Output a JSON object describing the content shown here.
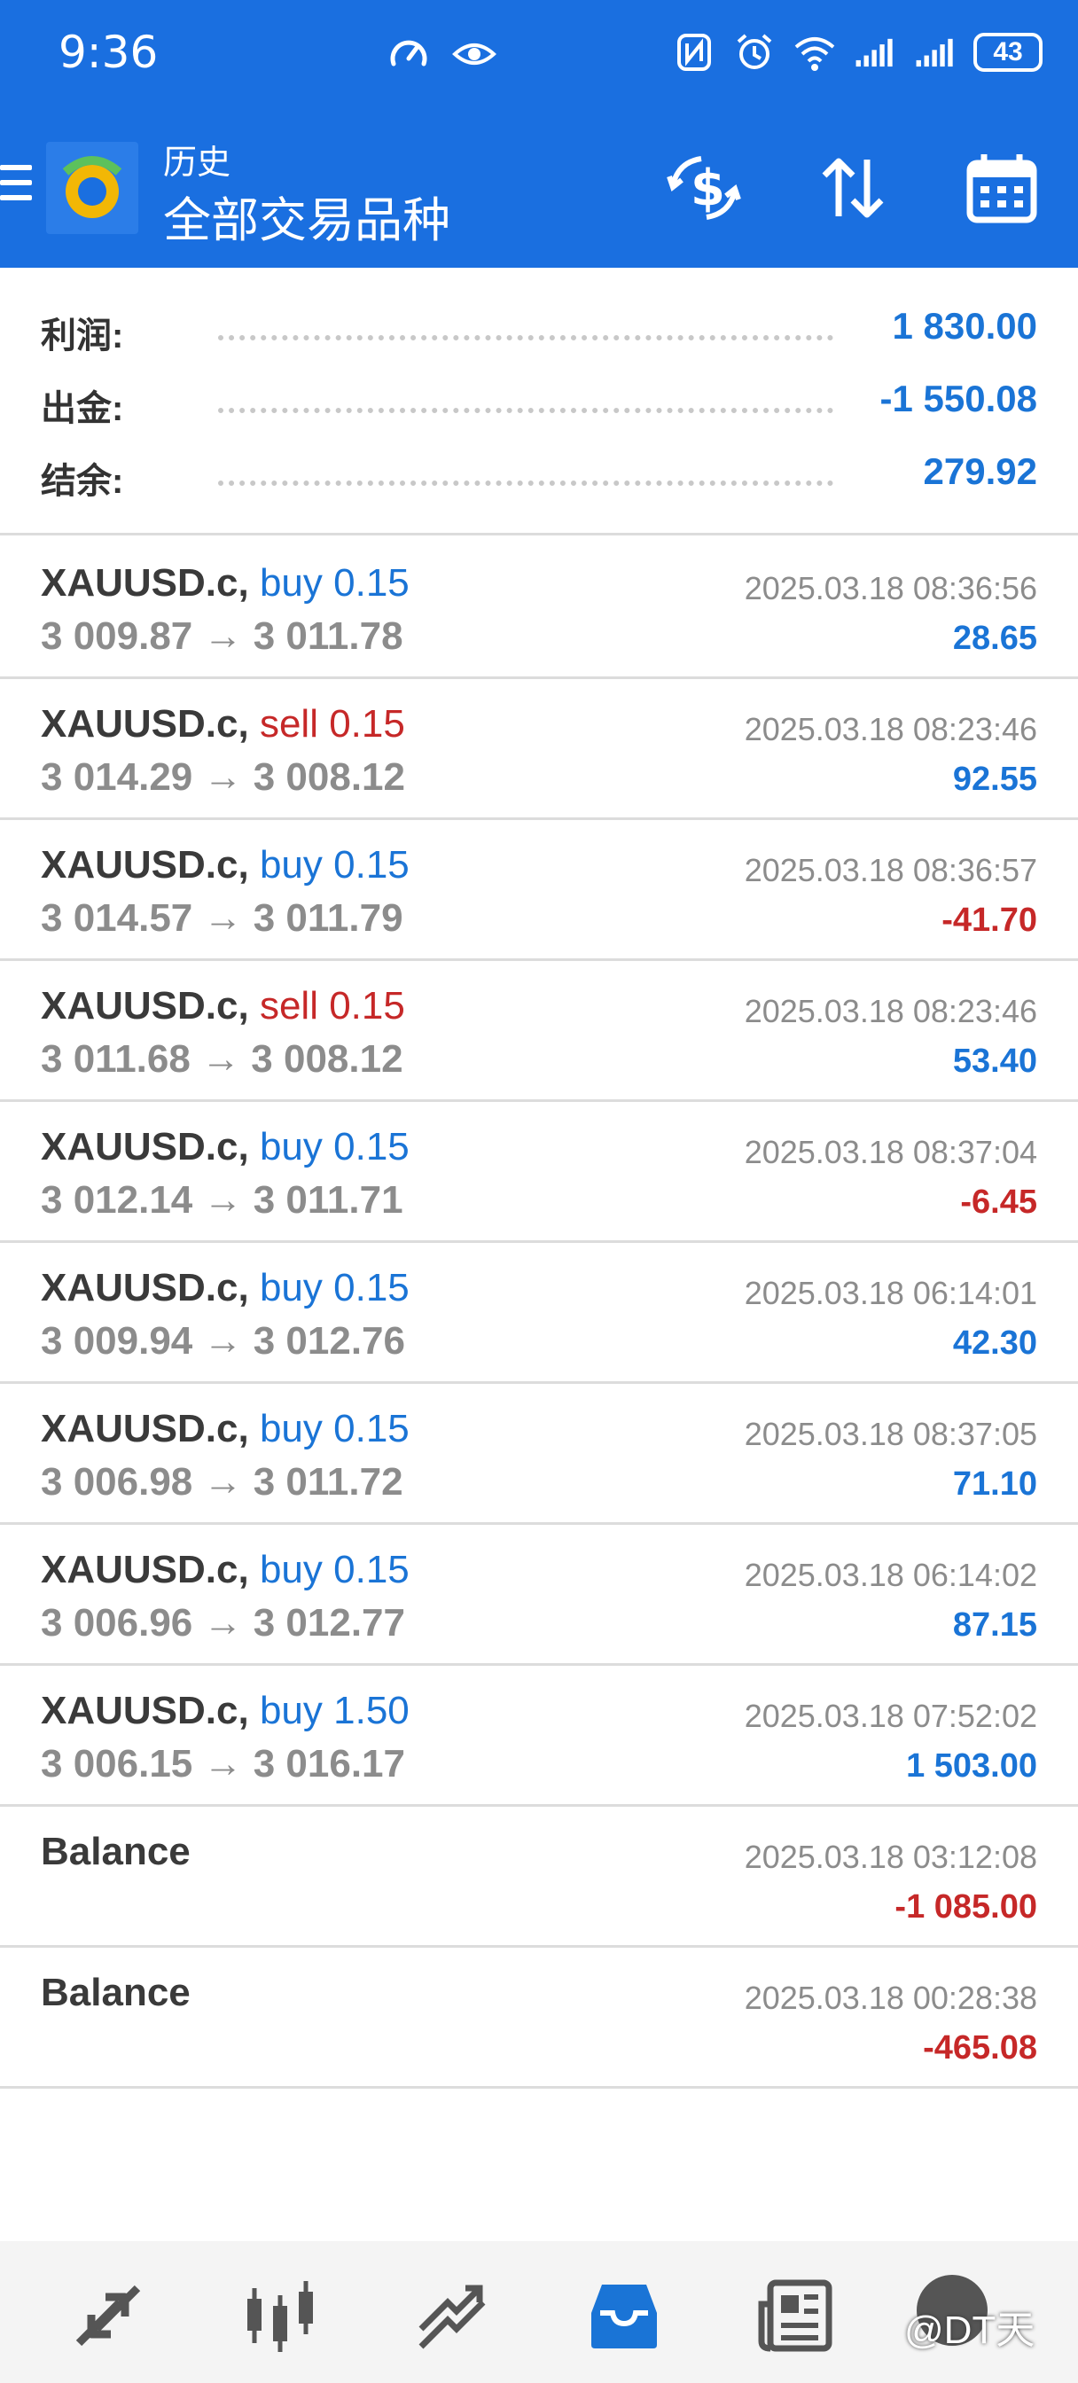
{
  "status_bar": {
    "time": "9:36",
    "battery": "43",
    "icons": [
      "speedometer-icon",
      "eye-icon",
      "nfc-icon",
      "alarm-icon",
      "wifi-icon",
      "signal-icon",
      "signal-icon",
      "battery-icon"
    ]
  },
  "header": {
    "subtitle": "历史",
    "title": "全部交易品种",
    "icons": [
      "menu-icon",
      "app-logo",
      "currency-exchange-icon",
      "sort-icon",
      "calendar-icon"
    ]
  },
  "summary": [
    {
      "label": "利润:",
      "value": "1 830.00"
    },
    {
      "label": "出金:",
      "value": "-1 550.08"
    },
    {
      "label": "结余:",
      "value": "279.92"
    }
  ],
  "deals": [
    {
      "symbol": "XAUUSD.c,",
      "type": "buy 0.15",
      "side": "buy",
      "prices": "3 009.87 → 3 011.78",
      "time": "2025.03.18 08:36:56",
      "profit": "28.65",
      "sign": "pos"
    },
    {
      "symbol": "XAUUSD.c,",
      "type": "sell 0.15",
      "side": "sell",
      "prices": "3 014.29 → 3 008.12",
      "time": "2025.03.18 08:23:46",
      "profit": "92.55",
      "sign": "pos"
    },
    {
      "symbol": "XAUUSD.c,",
      "type": "buy 0.15",
      "side": "buy",
      "prices": "3 014.57 → 3 011.79",
      "time": "2025.03.18 08:36:57",
      "profit": "-41.70",
      "sign": "neg"
    },
    {
      "symbol": "XAUUSD.c,",
      "type": "sell 0.15",
      "side": "sell",
      "prices": "3 011.68 → 3 008.12",
      "time": "2025.03.18 08:23:46",
      "profit": "53.40",
      "sign": "pos"
    },
    {
      "symbol": "XAUUSD.c,",
      "type": "buy 0.15",
      "side": "buy",
      "prices": "3 012.14 → 3 011.71",
      "time": "2025.03.18 08:37:04",
      "profit": "-6.45",
      "sign": "neg"
    },
    {
      "symbol": "XAUUSD.c,",
      "type": "buy 0.15",
      "side": "buy",
      "prices": "3 009.94 → 3 012.76",
      "time": "2025.03.18 06:14:01",
      "profit": "42.30",
      "sign": "pos"
    },
    {
      "symbol": "XAUUSD.c,",
      "type": "buy 0.15",
      "side": "buy",
      "prices": "3 006.98 → 3 011.72",
      "time": "2025.03.18 08:37:05",
      "profit": "71.10",
      "sign": "pos"
    },
    {
      "symbol": "XAUUSD.c,",
      "type": "buy 0.15",
      "side": "buy",
      "prices": "3 006.96 → 3 012.77",
      "time": "2025.03.18 06:14:02",
      "profit": "87.15",
      "sign": "pos"
    },
    {
      "symbol": "XAUUSD.c,",
      "type": "buy 1.50",
      "side": "buy",
      "prices": "3 006.15 → 3 016.17",
      "time": "2025.03.18 07:52:02",
      "profit": "1 503.00",
      "sign": "pos"
    },
    {
      "symbol": "Balance",
      "type": "",
      "side": "",
      "prices": "",
      "time": "2025.03.18 03:12:08",
      "profit": "-1 085.00",
      "sign": "neg"
    },
    {
      "symbol": "Balance",
      "type": "",
      "side": "",
      "prices": "",
      "time": "2025.03.18 00:28:38",
      "profit": "-465.08",
      "sign": "neg"
    }
  ],
  "bottom_nav": {
    "items": [
      "quotes-icon",
      "chart-icon",
      "trade-icon",
      "history-icon",
      "news-icon",
      "settings-avatar"
    ],
    "active": "history-icon",
    "watermark": "@DT天"
  },
  "colors": {
    "header_bg": "#1a6fe0",
    "positive": "#1a74d6",
    "negative": "#c62828",
    "muted": "#8c8c8c"
  }
}
